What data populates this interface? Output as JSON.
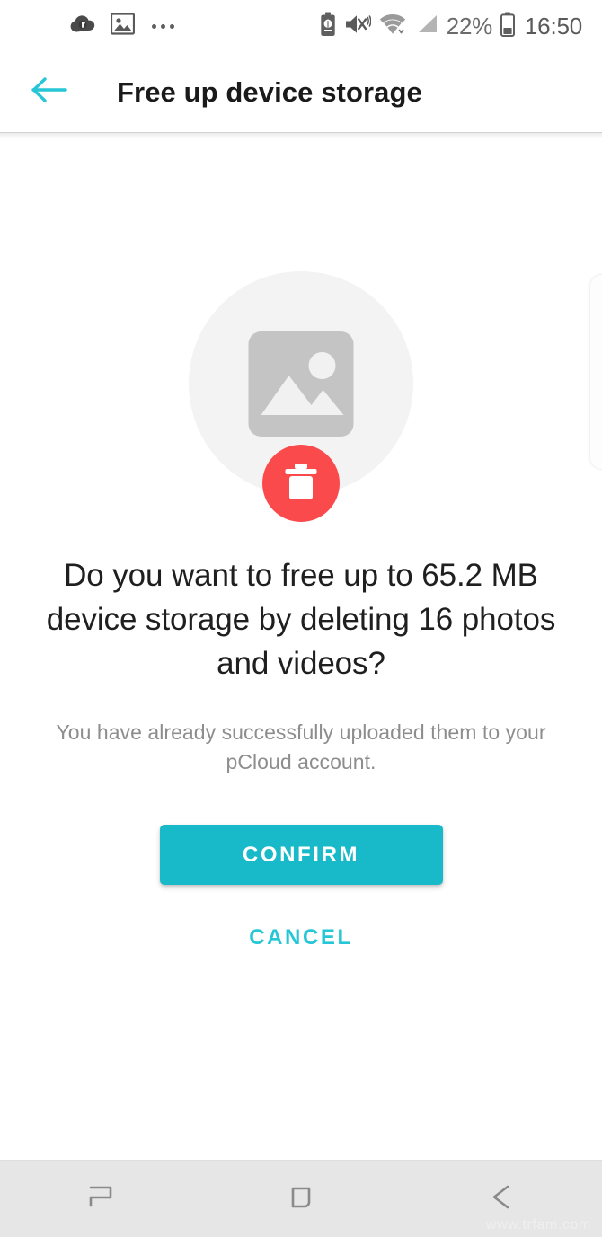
{
  "status_bar": {
    "left_icons": [
      {
        "name": "pcloud-notification-icon",
        "glyph": "cloud"
      },
      {
        "name": "gallery-notification-icon",
        "glyph": "image"
      },
      {
        "name": "more-notifications-icon",
        "glyph": "dots"
      }
    ],
    "right_icons": [
      {
        "name": "battery-saver-icon",
        "glyph": "battery-leaf"
      },
      {
        "name": "mute-vibrate-icon",
        "glyph": "mute"
      },
      {
        "name": "wifi-icon",
        "glyph": "wifi"
      },
      {
        "name": "cellular-signal-icon",
        "glyph": "signal"
      }
    ],
    "battery_percent": "22%",
    "clock": "16:50"
  },
  "app_bar": {
    "back_label": "Back",
    "title": "Free up device storage",
    "back_arrow_color": "#26c6d6"
  },
  "illustration": {
    "photo_icon_name": "image-placeholder-icon",
    "badge_icon_name": "trash-icon",
    "badge_color": "#fa4a4c",
    "circle_color": "#f3f3f3",
    "photo_color": "#c4c4c4"
  },
  "main": {
    "headline": "Do you want to free up to 65.2 MB device storage by deleting 16 photos and videos?",
    "subtext": "You have already successfully uploaded them to your pCloud account.",
    "storage_amount": "65.2 MB",
    "item_count": "16"
  },
  "actions": {
    "confirm_label": "CONFIRM",
    "cancel_label": "CANCEL",
    "confirm_color": "#18b9c8",
    "cancel_color": "#26c6d6"
  },
  "nav_bar": {
    "recents_label": "Recents",
    "home_label": "Home",
    "back_label": "Back"
  },
  "watermark": {
    "text": "www.trfam.com"
  }
}
